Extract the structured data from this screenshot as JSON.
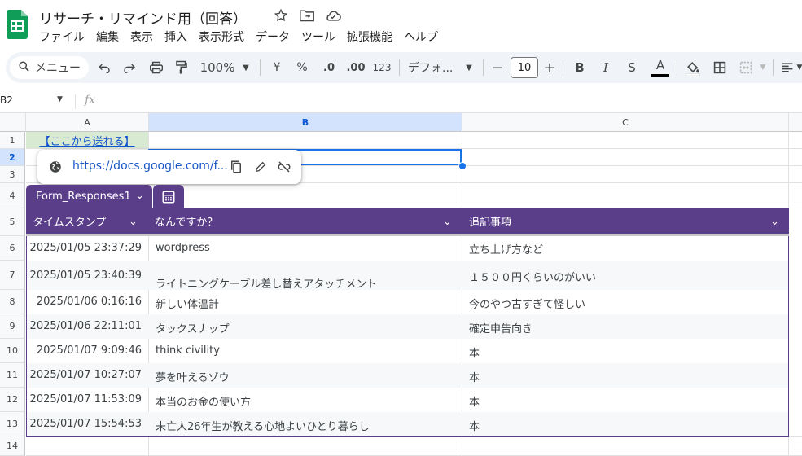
{
  "app": {
    "doc_title": "リサーチ・リマインド用（回答）",
    "menu": [
      "ファイル",
      "編集",
      "表示",
      "挿入",
      "表示形式",
      "データ",
      "ツール",
      "拡張機能",
      "ヘルプ"
    ]
  },
  "toolbar": {
    "menu_search": "メニュー",
    "zoom": "100%",
    "currency": "¥",
    "percent": "%",
    "decrease_decimal": ".0",
    "increase_decimal": ".00",
    "number_format": "123",
    "font": "デフォ...",
    "font_size": "10",
    "bold": "B",
    "italic": "I",
    "strikethrough": "S",
    "text_color": "A"
  },
  "formula_bar": {
    "name_box": "B2",
    "fx": "fx",
    "value": ""
  },
  "grid": {
    "columns": [
      "A",
      "B",
      "C"
    ],
    "rows": [
      "1",
      "2",
      "3",
      "4",
      "5",
      "6",
      "7",
      "8",
      "9",
      "10",
      "11",
      "12",
      "13",
      "14"
    ],
    "cell_a1": "【ここから送れる】"
  },
  "link_chip": {
    "url": "https://docs.google.com/f..."
  },
  "table": {
    "name": "Form_Responses1",
    "headers": [
      "タイムスタンプ",
      "なんですか？",
      "追記事項"
    ],
    "rows": [
      {
        "ts": "2025/01/05 23:37:29",
        "what": "wordpress",
        "note": "立ち上げ方など"
      },
      {
        "ts": "2025/01/05 23:40:39",
        "what": "ライトニングケーブル差し替えアタッチメント",
        "note": "１５００円くらいのがいい"
      },
      {
        "ts": "2025/01/06 0:16:16",
        "what": "新しい体温計",
        "note": "今のやつ古すぎて怪しい"
      },
      {
        "ts": "2025/01/06 22:11:01",
        "what": "タックスナップ",
        "note": "確定申告向き"
      },
      {
        "ts": "2025/01/07 9:09:46",
        "what": "think civility",
        "note": "本"
      },
      {
        "ts": "2025/01/07 10:27:07",
        "what": "夢を叶えるゾウ",
        "note": "本"
      },
      {
        "ts": "2025/01/07 11:53:09",
        "what": "本当のお金の使い方",
        "note": "本"
      },
      {
        "ts": "2025/01/07 15:54:53",
        "what": "未亡人26年生が教える心地よいひとり暮らし",
        "note": "本"
      }
    ]
  },
  "colors": {
    "accent": "#5b3e8a",
    "selection": "#1a73e8",
    "link": "#1155cc",
    "a1_fill": "#d9ead3"
  }
}
